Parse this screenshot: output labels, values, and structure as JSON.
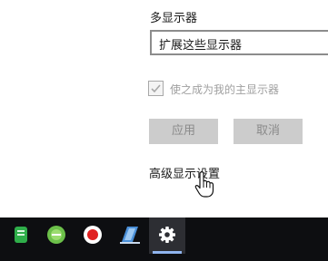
{
  "multi_display": {
    "title": "多显示器",
    "dropdown_value": "扩展这些显示器",
    "checkbox_label": "使之成为我的主显示器",
    "checkbox_checked": true,
    "apply_label": "应用",
    "cancel_label": "取消",
    "advanced_link": "高级显示设置"
  },
  "taskbar": {
    "items": [
      {
        "icon": "green-app-icon"
      },
      {
        "icon": "green-circle-app-icon"
      },
      {
        "icon": "record-icon"
      },
      {
        "icon": "blue-app-icon"
      },
      {
        "icon": "gear-icon",
        "active": true
      }
    ],
    "colors": {
      "background": "#0d0e11",
      "active": "#2d2e33",
      "accent": "#8fb4ee"
    }
  }
}
